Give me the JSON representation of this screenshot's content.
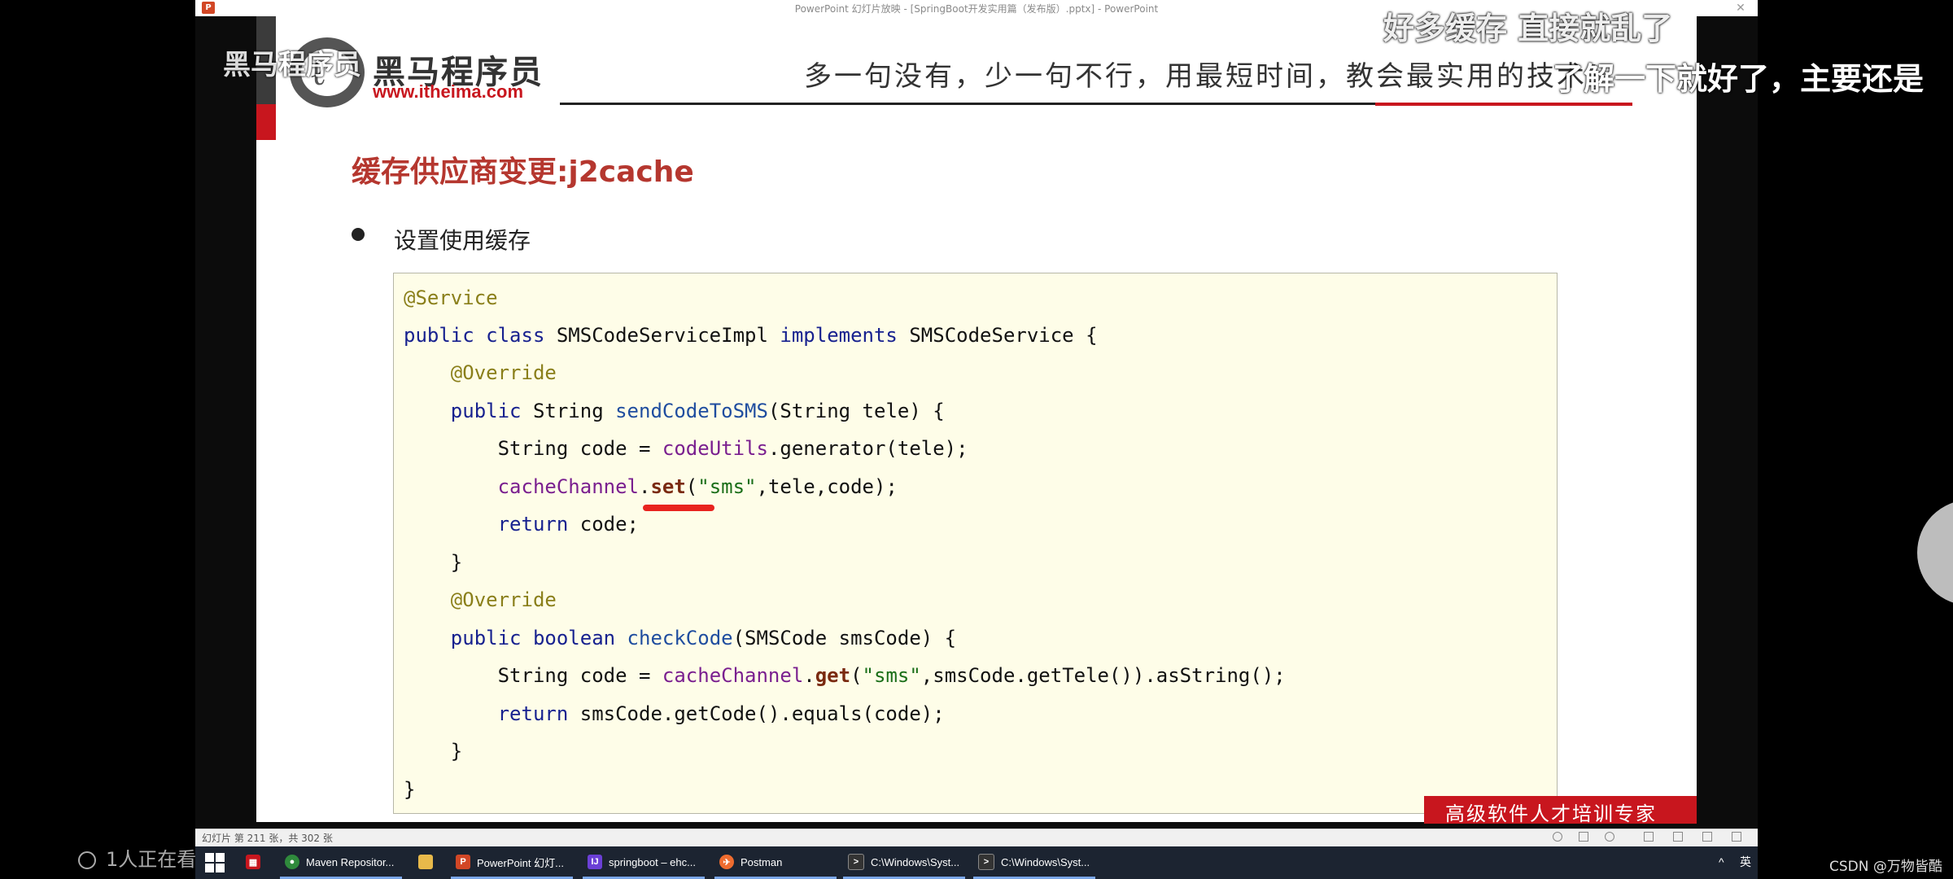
{
  "window": {
    "title": "PowerPoint 幻灯片放映 - [SpringBoot开发实用篇（发布版）.pptx] - PowerPoint",
    "app_icon": "P",
    "close": "✕"
  },
  "slide": {
    "logo_name": "黑马程序员",
    "logo_url": "www.itheima.com",
    "slogan": "多一句没有，少一句不行，用最短时间，教会最实用的技术！",
    "title": "缓存供应商变更:j2cache",
    "bullet": "设置使用缓存",
    "footer_slogan": "高级软件人才培训专家",
    "code": {
      "l1_ann": "@Service",
      "l2_kw1": "public class ",
      "l2_name": "SMSCodeServiceImpl ",
      "l2_kw2": "implements ",
      "l2_rest": "SMSCodeService {",
      "l3_ann": "@Override",
      "l4_kw": "public ",
      "l4_type": "String ",
      "l4_method": "sendCodeToSMS",
      "l4_rest": "(String tele) {",
      "l5_a": "String code = ",
      "l5_field": "codeUtils",
      "l5_b": ".generator(tele);",
      "l6_field": "cacheChannel",
      "l6_dot": ".",
      "l6_method": "set",
      "l6_open": "(",
      "l6_str": "\"sms\"",
      "l6_rest": ",tele,code);",
      "l7_kw": "return ",
      "l7_rest": "code;",
      "l8": "}",
      "l9_ann": "@Override",
      "l10_kw1": "public ",
      "l10_kw2": "boolean ",
      "l10_method": "checkCode",
      "l10_rest": "(SMSCode smsCode) {",
      "l11_a": "String code = ",
      "l11_field": "cacheChannel",
      "l11_dot": ".",
      "l11_method": "get",
      "l11_open": "(",
      "l11_str": "\"sms\"",
      "l11_rest": ",smsCode.getTele()).asString();",
      "l12_kw": "return ",
      "l12_rest": "smsCode.getCode().equals(code);",
      "l13": "}",
      "l14": "}"
    }
  },
  "statusbar": {
    "text": "幻灯片 第 211 张，共 302 张"
  },
  "taskbar": {
    "items": [
      {
        "label": "Maven Repositor...",
        "icon": "chrome-icon",
        "color": "#e0a800"
      },
      {
        "label": "",
        "icon": "folder-icon",
        "color": "#e8b94a"
      },
      {
        "label": "PowerPoint 幻灯...",
        "icon": "powerpoint-icon",
        "color": "#d24726"
      },
      {
        "label": "springboot – ehc...",
        "icon": "intellij-icon",
        "color": "#6b3fd6"
      },
      {
        "label": "Postman",
        "icon": "postman-icon",
        "color": "#ef6c2f"
      },
      {
        "label": "C:\\Windows\\Syst...",
        "icon": "cmd-icon",
        "color": "#333333"
      },
      {
        "label": "C:\\Windows\\Syst...",
        "icon": "cmd-icon",
        "color": "#333333"
      }
    ],
    "tray_ime": "英",
    "tray_arrow": "^"
  },
  "overlays": {
    "subtitle_top": "好多缓存  直接就乱了",
    "subtitle_right": "了解一下就好了，主要还是",
    "watermark_left": "黑马程序员",
    "viewer_count": "1人正在看",
    "csdn": "CSDN @万物皆酷"
  },
  "colors": {
    "accent_red": "#c8161e",
    "title_red": "#b5372f",
    "code_bg": "#fefde8",
    "taskbar": "#1c2431"
  }
}
